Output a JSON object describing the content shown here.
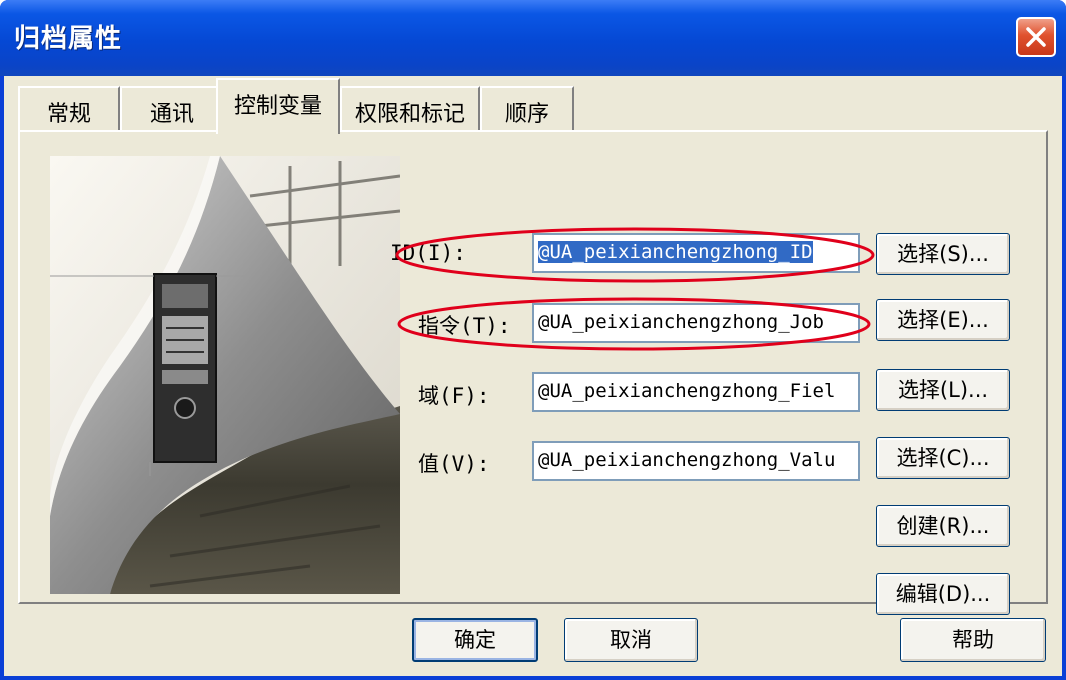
{
  "window": {
    "title": "归档属性"
  },
  "tabs": [
    {
      "label": "常规"
    },
    {
      "label": "通讯"
    },
    {
      "label": "控制变量"
    },
    {
      "label": "权限和标记"
    },
    {
      "label": "顺序"
    }
  ],
  "active_tab": "控制变量",
  "fields": [
    {
      "label": "ID(I):",
      "value": "@UA_peixianchengzhong_ID",
      "button": "选择(S)...",
      "selected": true,
      "highlighted": true
    },
    {
      "label": "指令(T):",
      "value": "@UA_peixianchengzhong_Job",
      "button": "选择(E)...",
      "selected": false,
      "highlighted": true
    },
    {
      "label": "域(F):",
      "value": "@UA_peixianchengzhong_Fiel",
      "button": "选择(L)...",
      "selected": false,
      "highlighted": false
    },
    {
      "label": "值(V):",
      "value": "@UA_peixianchengzhong_Valu",
      "button": "选择(C)...",
      "selected": false,
      "highlighted": false
    }
  ],
  "extra_buttons": {
    "create": "创建(R)...",
    "edit": "编辑(D)..."
  },
  "footer": {
    "ok": "确定",
    "cancel": "取消",
    "help": "帮助"
  },
  "colors": {
    "titlebar": "#0548d4",
    "close": "#e0522e",
    "highlight_ellipse": "#e0001b",
    "selection": "#316ac5"
  }
}
